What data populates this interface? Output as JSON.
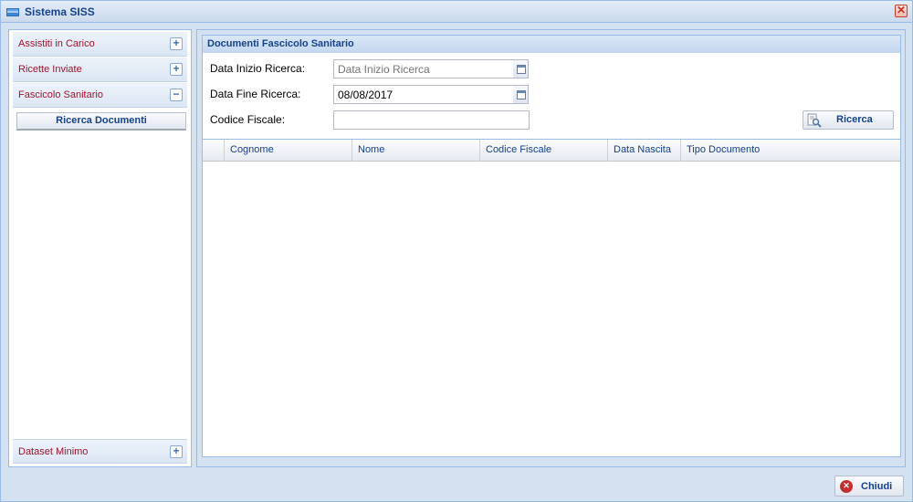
{
  "window": {
    "title": "Sistema SISS",
    "close_glyph": "✕"
  },
  "accordion": {
    "items": [
      {
        "label": "Assistiti in Carico",
        "toggle": "+"
      },
      {
        "label": "Ricette Inviate",
        "toggle": "+"
      },
      {
        "label": "Fascicolo Sanitario",
        "toggle": "−"
      },
      {
        "label": "Dataset Minimo",
        "toggle": "+"
      }
    ],
    "sub_button": "Ricerca Documenti"
  },
  "panel": {
    "title": "Documenti Fascicolo Sanitario"
  },
  "form": {
    "data_inizio_label": "Data Inizio Ricerca:",
    "data_inizio_placeholder": "Data Inizio Ricerca",
    "data_fine_label": "Data Fine Ricerca:",
    "data_fine_value": "08/08/2017",
    "codice_fiscale_label": "Codice Fiscale:",
    "codice_fiscale_value": "",
    "search_button": "Ricerca"
  },
  "grid": {
    "columns": [
      "Cognome",
      "Nome",
      "Codice Fiscale",
      "Data Nascita",
      "Tipo Documento"
    ],
    "rows": []
  },
  "footer": {
    "close_button": "Chiudi"
  },
  "colors": {
    "accent": "#15428b",
    "link_red": "#a4132b",
    "border": "#99bbe8"
  }
}
